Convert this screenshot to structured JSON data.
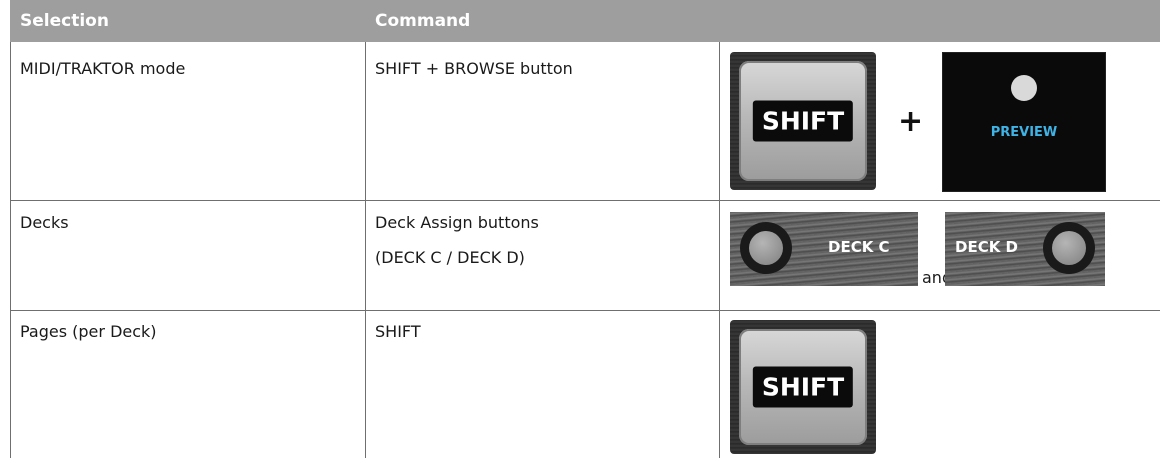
{
  "header": {
    "selection": "Selection",
    "command": "Command"
  },
  "rows": [
    {
      "selection": "MIDI/TRAKTOR mode",
      "command": "SHIFT + BROWSE button"
    },
    {
      "selection": "Decks",
      "command_line1": "Deck Assign buttons",
      "command_line2": "(DECK C / DECK D)"
    },
    {
      "selection": "Pages (per Deck)",
      "command": "SHIFT"
    }
  ],
  "images": {
    "shift_label": "SHIFT",
    "plus": "+",
    "preview_label": "PREVIEW",
    "deck_c_label": "DECK C",
    "deck_d_label": "DECK D",
    "and_text": "and"
  },
  "icons": {
    "preview": "headphones-icon"
  }
}
